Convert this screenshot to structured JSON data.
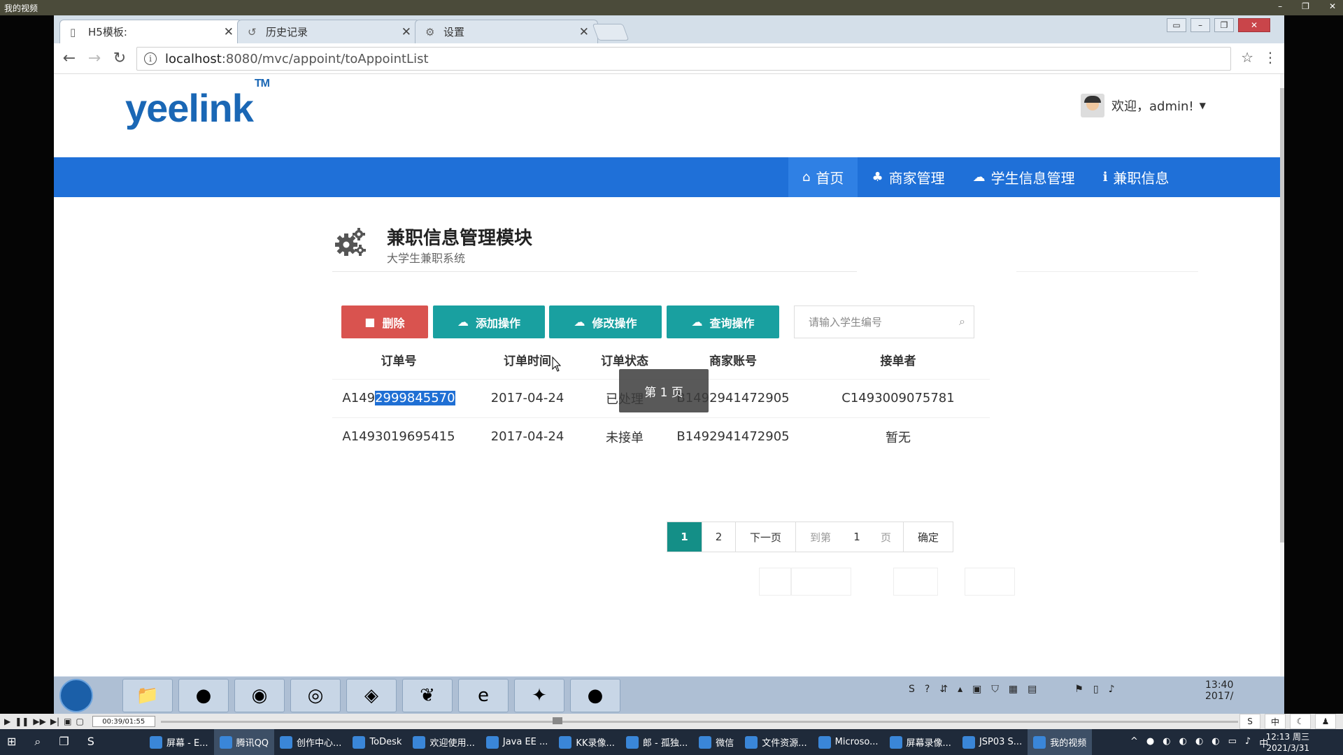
{
  "player": {
    "title": "我的视频",
    "controls": [
      "–",
      "❐",
      "✕"
    ],
    "time": "00:39/01:55"
  },
  "browser": {
    "tabs": [
      {
        "label": "H5模板:",
        "icon": "page-icon",
        "close": "✕"
      },
      {
        "label": "历史记录",
        "icon": "history-icon",
        "close": "✕"
      },
      {
        "label": "设置",
        "icon": "gear-icon",
        "close": "✕"
      }
    ],
    "url_host": "localhost",
    "url_path": ":8080/mvc/appoint/toAppointList"
  },
  "site": {
    "logo": "yeelink",
    "logo_tm": "TM",
    "user_greeting": "欢迎，admin!",
    "nav": [
      {
        "label": "首页",
        "icon": "home-icon",
        "glyph": "⌂"
      },
      {
        "label": "商家管理",
        "icon": "sitemap-icon",
        "glyph": "♣"
      },
      {
        "label": "学生信息管理",
        "icon": "cloud-icon",
        "glyph": "☁"
      },
      {
        "label": "兼职信息",
        "icon": "info-icon",
        "glyph": "ℹ"
      }
    ],
    "module_title": "兼职信息管理模块",
    "module_subtitle": "大学生兼职系统",
    "buttons": {
      "delete": "删除",
      "add": "添加操作",
      "modify": "修改操作",
      "query": "查询操作"
    },
    "search_placeholder": "请输入学生编号",
    "table": {
      "headers": [
        "订单号",
        "订单时间",
        "订单状态",
        "商家账号",
        "接单者"
      ],
      "rows": [
        {
          "order_prefix": "A149",
          "order_selected": "2999845570",
          "time": "2017-04-24",
          "status": "已处理",
          "merchant": "B1492941472905",
          "taker": "C1493009075781"
        },
        {
          "order_id": "A1493019695415",
          "time": "2017-04-24",
          "status": "未接单",
          "merchant": "B1492941472905",
          "taker": "暂无"
        }
      ]
    },
    "tooltip": "第 1 页",
    "pagination": {
      "pages": [
        "1",
        "2"
      ],
      "current": "1",
      "next": "下一页",
      "goto_label": "到第",
      "goto_value": "1",
      "page_unit": "页",
      "confirm": "确定"
    }
  },
  "win7_tray": {
    "time": "13:40",
    "date": "2017/"
  },
  "win10_taskbar": {
    "apps": [
      "屏幕 - E...",
      "腾讯QQ",
      "创作中心...",
      "ToDesk",
      "欢迎使用...",
      "Java EE ...",
      "KK录像...",
      "郎 - 孤独...",
      "微信",
      "文件资源...",
      "Microso...",
      "屏幕录像...",
      "JSP03 S...",
      "我的视频"
    ],
    "time": "12:13 周三",
    "date": "2021/3/31",
    "ime": "中"
  },
  "colors": {
    "navbar": "#1f70d8",
    "teal_button": "#19a0a0",
    "danger_button": "#d9534f",
    "logo": "#1a67b5"
  }
}
